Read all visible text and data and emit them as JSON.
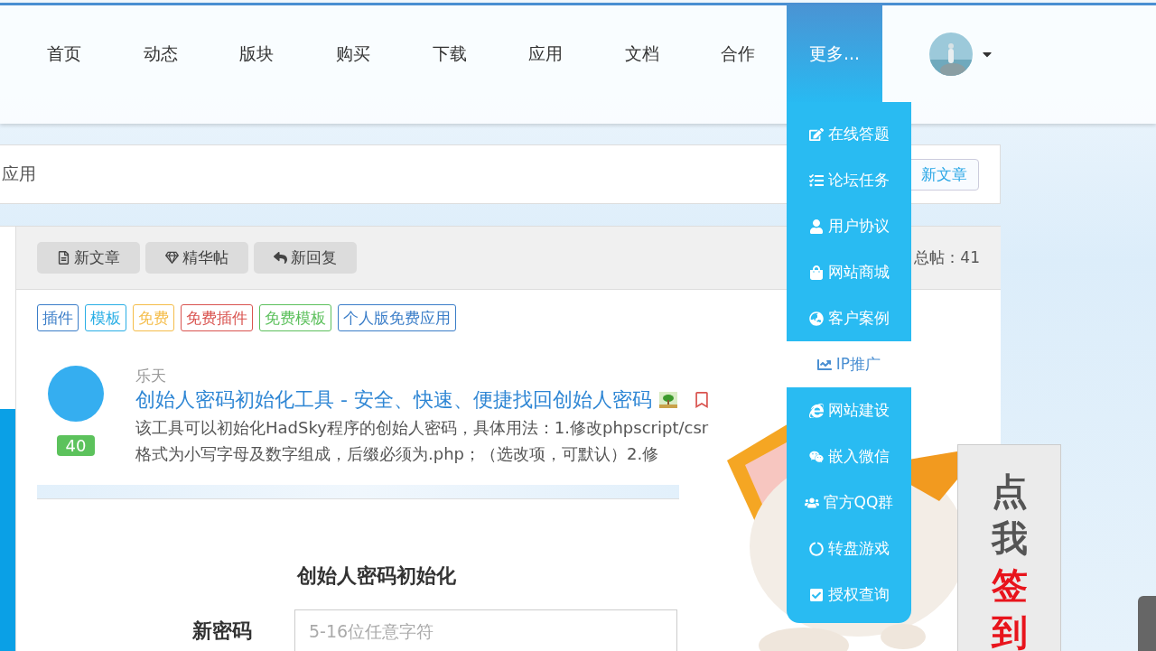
{
  "nav": {
    "items": [
      {
        "label": "首页",
        "selected": false
      },
      {
        "label": "动态",
        "selected": false
      },
      {
        "label": "版块",
        "selected": false
      },
      {
        "label": "购买",
        "selected": false
      },
      {
        "label": "下载",
        "selected": false
      },
      {
        "label": "应用",
        "selected": false
      },
      {
        "label": "文档",
        "selected": false
      },
      {
        "label": "合作",
        "selected": false
      },
      {
        "label": "更多...",
        "selected": true
      }
    ]
  },
  "more_menu": {
    "items": [
      {
        "label": "在线答题",
        "selected": false
      },
      {
        "label": "论坛任务",
        "selected": false
      },
      {
        "label": "用户协议",
        "selected": false
      },
      {
        "label": "网站商城",
        "selected": false
      },
      {
        "label": "客户案例",
        "selected": false
      },
      {
        "label": "IP推广",
        "selected": true
      },
      {
        "label": "网站建设",
        "selected": false
      },
      {
        "label": "嵌入微信",
        "selected": false
      },
      {
        "label": "官方QQ群",
        "selected": false
      },
      {
        "label": "转盘游戏",
        "selected": false
      },
      {
        "label": "授权查询",
        "selected": false
      }
    ]
  },
  "breadcrumb": {
    "text": "应用",
    "button": "新文章"
  },
  "board": {
    "buttons": [
      "新文章",
      "精华帖",
      "新回复"
    ],
    "stats": "总帖：41",
    "tags": [
      {
        "label": "插件",
        "color": "#3a7dc8"
      },
      {
        "label": "模板",
        "color": "#29aee5"
      },
      {
        "label": "免费",
        "color": "#f5bd4a"
      },
      {
        "label": "免费插件",
        "color": "#d9534f"
      },
      {
        "label": "免费模板",
        "color": "#5cc05c"
      },
      {
        "label": "个人版免费应用",
        "color": "#3a7dc8"
      }
    ]
  },
  "post": {
    "score": "40",
    "author": "乐天",
    "title": "创始人密码初始化工具 - 安全、快速、便捷找回创始人密码",
    "summary": [
      "该工具可以初始化HadSky程序的创始人密码，具体用法：1.修改phpscript/csr",
      "格式为小写字母及数字组成，后缀必须为.php；（选改项，可默认）2.修"
    ],
    "preview": {
      "heading": "创始人密码初始化",
      "label": "新密码",
      "placeholder": "5-16位任意字符"
    }
  },
  "sign_widget": {
    "lines": [
      {
        "text": "点我",
        "kind": "plain"
      },
      {
        "text": "签到",
        "kind": "highlight"
      }
    ]
  }
}
